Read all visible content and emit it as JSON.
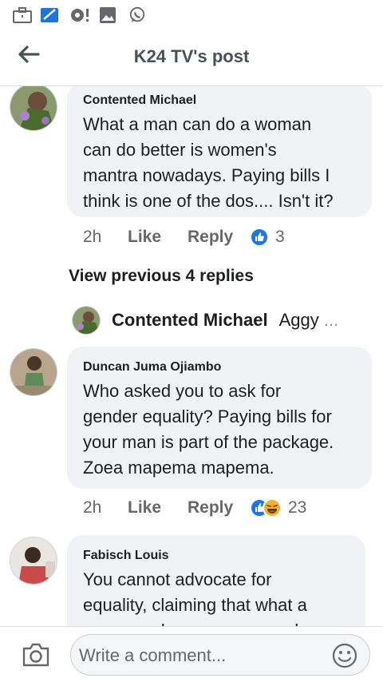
{
  "header": {
    "title": "K24 TV's post"
  },
  "comments": [
    {
      "author": "Contented Michael",
      "lines": [
        "What a man can do a woman",
        "can do better is women's",
        "mantra nowadays. Paying bills I",
        "think is one of the dos.... Isn't it?"
      ],
      "time": "2h",
      "like_label": "Like",
      "reply_label": "Reply",
      "reaction_count": "3"
    },
    {
      "author": "Duncan Juma Ojiambo",
      "lines": [
        "Who asked you to ask for",
        "gender equality? Paying bills for",
        "your man is part of the package.",
        "Zoea mapema mapema."
      ],
      "time": "2h",
      "like_label": "Like",
      "reply_label": "Reply",
      "reaction_count": "23"
    },
    {
      "author": "Fabisch Louis",
      "lines": [
        "You cannot advocate for",
        "equality, claiming that what a",
        "man can do a woman can do"
      ]
    }
  ],
  "thread": {
    "view_previous": "View previous 4 replies",
    "reply_author": "Contented Michael",
    "reply_snippet": "Aggy",
    "ellipsis": "..."
  },
  "composer": {
    "placeholder": "Write a comment..."
  },
  "colors": {
    "like_blue": "#1877f2",
    "haha_yellow": "#f7b125",
    "bubble": "#f0f2f5"
  },
  "icons": [
    "briefcase-icon",
    "gallery-icon",
    "settings-notification-icon",
    "image-icon",
    "whatsapp-icon",
    "back-arrow-icon",
    "camera-icon",
    "emoji-icon",
    "like-reaction-icon",
    "haha-reaction-icon"
  ]
}
